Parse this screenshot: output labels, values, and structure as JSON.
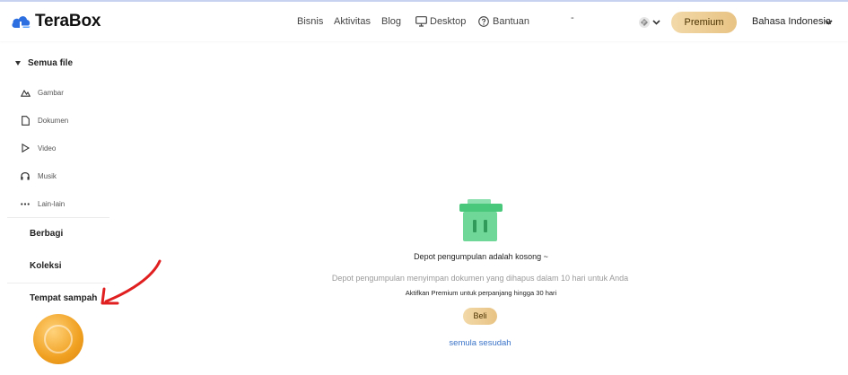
{
  "header": {
    "logo_text": "TeraBox",
    "nav": {
      "bisnis": "Bisnis",
      "aktivitas": "Aktivitas",
      "blog": "Blog",
      "desktop": "Desktop",
      "bantuan": "Bantuan",
      "dash": "-"
    },
    "premium_label": "Premium",
    "language_label": "Bahasa Indonesia"
  },
  "sidebar": {
    "all_files": "Semua file",
    "categories": {
      "gambar": "Gambar",
      "dokumen": "Dokumen",
      "video": "Video",
      "musik": "Musik",
      "lain": "Lain-lain"
    },
    "berbagi": "Berbagi",
    "koleksi": "Koleksi",
    "tempat_sampah": "Tempat sampah"
  },
  "main": {
    "empty_title": "Depot pengumpulan adalah kosong ~",
    "empty_description": "Depot pengumpulan menyimpan dokumen yang dihapus dalam 10 hari untuk Anda",
    "premium_note": "Aktifkan Premium untuk perpanjang hingga 30 hari",
    "buy_label": "Beli",
    "restore_link": "semula sesudah"
  },
  "colors": {
    "brand_blue": "#2d6fe0",
    "premium_gold": "#e8c384",
    "trash_green": "#5fd08a",
    "link_blue": "#3a73c8",
    "annotation_red": "#e02020"
  }
}
